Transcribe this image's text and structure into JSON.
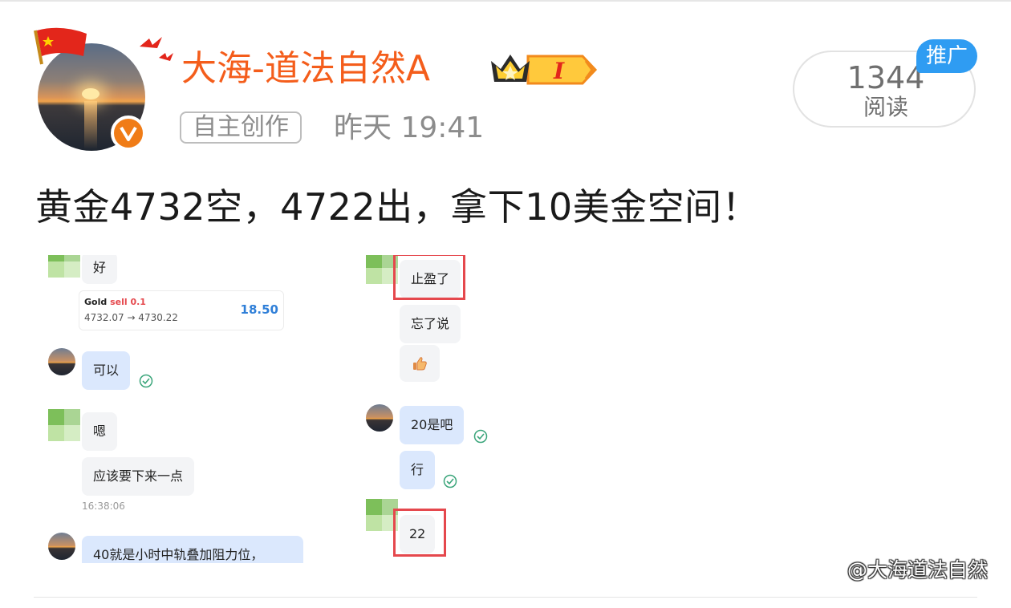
{
  "post": {
    "author": "大海-道法自然A",
    "tag": "自主创作",
    "time": "昨天 19:41",
    "reads_count": "1344",
    "reads_label": "阅读",
    "promo_badge": "推广",
    "title": "黄金4732空，4722出，拿下10美金空间！",
    "watermark": "@大海道法自然"
  },
  "chat_left": {
    "msg_ok": "好",
    "trade": {
      "symbol": "Gold",
      "side": "sell 0.1",
      "prices": "4732.07 → 4730.22",
      "profit": "18.50"
    },
    "msg_can": "可以",
    "msg_hm": "嗯",
    "msg_should": "应该要下来一点",
    "timestamp": "16:38:06",
    "msg_40": "40就是小时中轨叠加阻力位，"
  },
  "chat_right": {
    "msg_tp": "止盈了",
    "msg_forgot": "忘了说",
    "msg_20": "20是吧",
    "msg_ok": "行",
    "msg_22": "22"
  },
  "colors": {
    "author": "#f45d1b",
    "promo": "#2f9cf2",
    "verified": "#f07c17",
    "highlight": "#e5484d",
    "profit": "#2f7fd8",
    "blue_bubble": "#dbe8fd"
  },
  "icons": [
    "flag-icon",
    "birds-icon",
    "verified-icon",
    "crown-badge-icon",
    "thumbs-up-icon",
    "check-icon",
    "weibo-logo-icon"
  ]
}
